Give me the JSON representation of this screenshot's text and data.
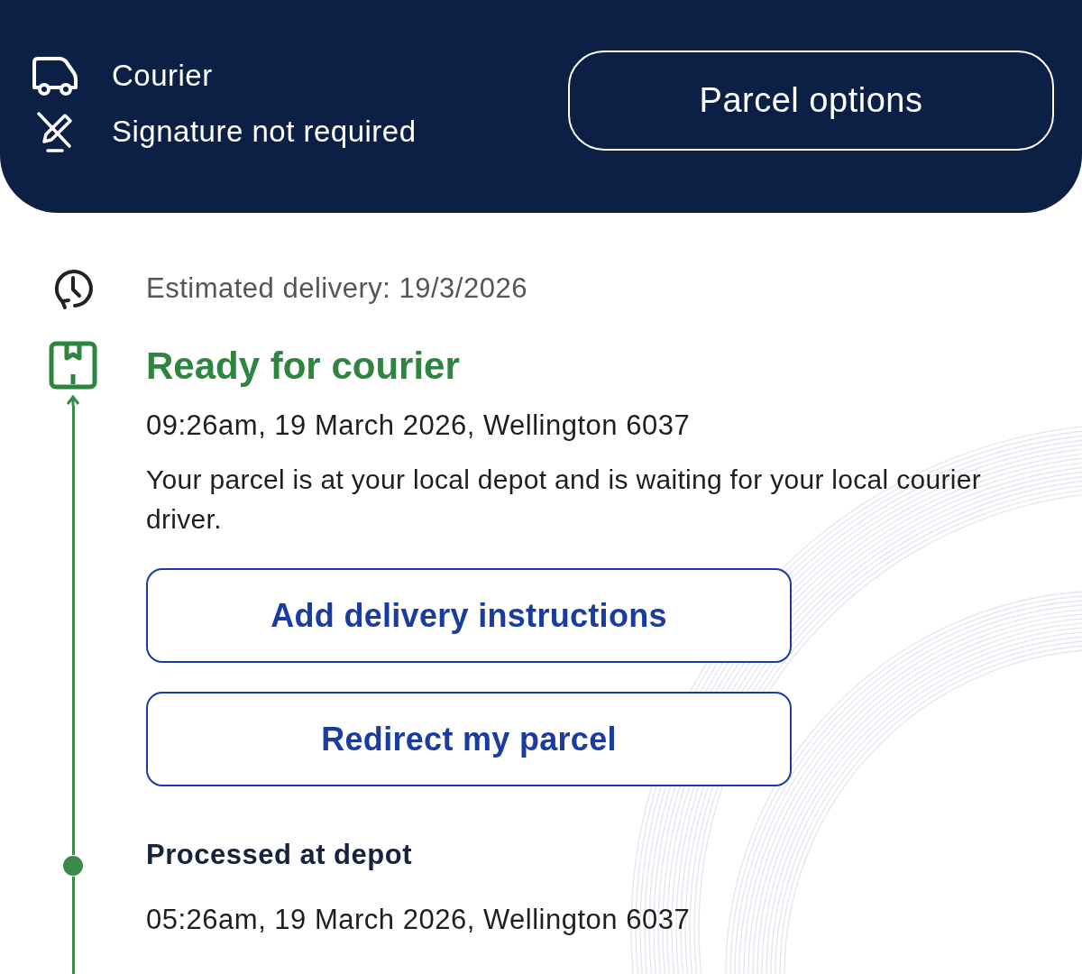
{
  "header": {
    "service_rows": [
      {
        "kind": "courier",
        "label": "Courier"
      },
      {
        "kind": "no-signature",
        "label": "Signature not required"
      }
    ],
    "options_button": "Parcel options"
  },
  "estimate": {
    "label": "Estimated delivery: 19/3/2026"
  },
  "events": [
    {
      "kind": "current",
      "title": "Ready for courier",
      "detail": "09:26am, 19 March 2026, Wellington 6037",
      "description": "Your parcel is at your local depot and is waiting for your local courier driver.",
      "actions": [
        "Add delivery instructions",
        "Redirect my parcel"
      ]
    },
    {
      "kind": "past",
      "title": "Processed at depot",
      "detail": "05:26am, 19 March 2026, Wellington 6037"
    }
  ]
}
